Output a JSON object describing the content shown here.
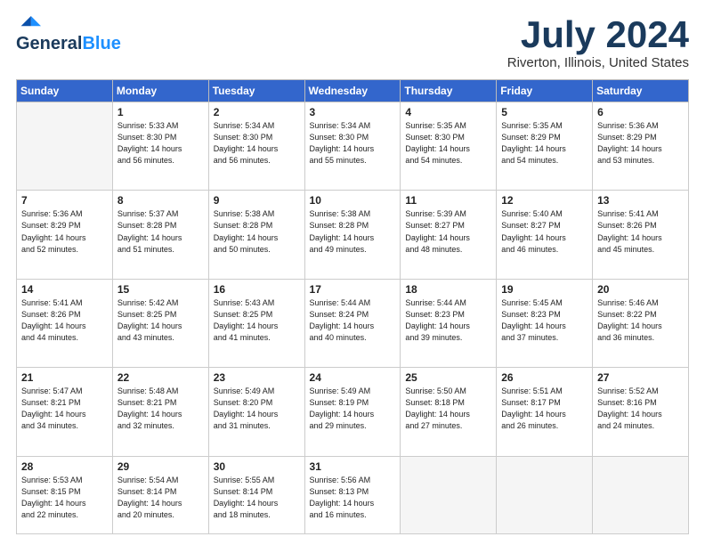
{
  "logo": {
    "name": "General",
    "name2": "Blue"
  },
  "title": "July 2024",
  "subtitle": "Riverton, Illinois, United States",
  "days": [
    "Sunday",
    "Monday",
    "Tuesday",
    "Wednesday",
    "Thursday",
    "Friday",
    "Saturday"
  ],
  "weeks": [
    [
      {
        "num": "",
        "info": ""
      },
      {
        "num": "1",
        "info": "Sunrise: 5:33 AM\nSunset: 8:30 PM\nDaylight: 14 hours\nand 56 minutes."
      },
      {
        "num": "2",
        "info": "Sunrise: 5:34 AM\nSunset: 8:30 PM\nDaylight: 14 hours\nand 56 minutes."
      },
      {
        "num": "3",
        "info": "Sunrise: 5:34 AM\nSunset: 8:30 PM\nDaylight: 14 hours\nand 55 minutes."
      },
      {
        "num": "4",
        "info": "Sunrise: 5:35 AM\nSunset: 8:30 PM\nDaylight: 14 hours\nand 54 minutes."
      },
      {
        "num": "5",
        "info": "Sunrise: 5:35 AM\nSunset: 8:29 PM\nDaylight: 14 hours\nand 54 minutes."
      },
      {
        "num": "6",
        "info": "Sunrise: 5:36 AM\nSunset: 8:29 PM\nDaylight: 14 hours\nand 53 minutes."
      }
    ],
    [
      {
        "num": "7",
        "info": "Sunrise: 5:36 AM\nSunset: 8:29 PM\nDaylight: 14 hours\nand 52 minutes."
      },
      {
        "num": "8",
        "info": "Sunrise: 5:37 AM\nSunset: 8:28 PM\nDaylight: 14 hours\nand 51 minutes."
      },
      {
        "num": "9",
        "info": "Sunrise: 5:38 AM\nSunset: 8:28 PM\nDaylight: 14 hours\nand 50 minutes."
      },
      {
        "num": "10",
        "info": "Sunrise: 5:38 AM\nSunset: 8:28 PM\nDaylight: 14 hours\nand 49 minutes."
      },
      {
        "num": "11",
        "info": "Sunrise: 5:39 AM\nSunset: 8:27 PM\nDaylight: 14 hours\nand 48 minutes."
      },
      {
        "num": "12",
        "info": "Sunrise: 5:40 AM\nSunset: 8:27 PM\nDaylight: 14 hours\nand 46 minutes."
      },
      {
        "num": "13",
        "info": "Sunrise: 5:41 AM\nSunset: 8:26 PM\nDaylight: 14 hours\nand 45 minutes."
      }
    ],
    [
      {
        "num": "14",
        "info": "Sunrise: 5:41 AM\nSunset: 8:26 PM\nDaylight: 14 hours\nand 44 minutes."
      },
      {
        "num": "15",
        "info": "Sunrise: 5:42 AM\nSunset: 8:25 PM\nDaylight: 14 hours\nand 43 minutes."
      },
      {
        "num": "16",
        "info": "Sunrise: 5:43 AM\nSunset: 8:25 PM\nDaylight: 14 hours\nand 41 minutes."
      },
      {
        "num": "17",
        "info": "Sunrise: 5:44 AM\nSunset: 8:24 PM\nDaylight: 14 hours\nand 40 minutes."
      },
      {
        "num": "18",
        "info": "Sunrise: 5:44 AM\nSunset: 8:23 PM\nDaylight: 14 hours\nand 39 minutes."
      },
      {
        "num": "19",
        "info": "Sunrise: 5:45 AM\nSunset: 8:23 PM\nDaylight: 14 hours\nand 37 minutes."
      },
      {
        "num": "20",
        "info": "Sunrise: 5:46 AM\nSunset: 8:22 PM\nDaylight: 14 hours\nand 36 minutes."
      }
    ],
    [
      {
        "num": "21",
        "info": "Sunrise: 5:47 AM\nSunset: 8:21 PM\nDaylight: 14 hours\nand 34 minutes."
      },
      {
        "num": "22",
        "info": "Sunrise: 5:48 AM\nSunset: 8:21 PM\nDaylight: 14 hours\nand 32 minutes."
      },
      {
        "num": "23",
        "info": "Sunrise: 5:49 AM\nSunset: 8:20 PM\nDaylight: 14 hours\nand 31 minutes."
      },
      {
        "num": "24",
        "info": "Sunrise: 5:49 AM\nSunset: 8:19 PM\nDaylight: 14 hours\nand 29 minutes."
      },
      {
        "num": "25",
        "info": "Sunrise: 5:50 AM\nSunset: 8:18 PM\nDaylight: 14 hours\nand 27 minutes."
      },
      {
        "num": "26",
        "info": "Sunrise: 5:51 AM\nSunset: 8:17 PM\nDaylight: 14 hours\nand 26 minutes."
      },
      {
        "num": "27",
        "info": "Sunrise: 5:52 AM\nSunset: 8:16 PM\nDaylight: 14 hours\nand 24 minutes."
      }
    ],
    [
      {
        "num": "28",
        "info": "Sunrise: 5:53 AM\nSunset: 8:15 PM\nDaylight: 14 hours\nand 22 minutes."
      },
      {
        "num": "29",
        "info": "Sunrise: 5:54 AM\nSunset: 8:14 PM\nDaylight: 14 hours\nand 20 minutes."
      },
      {
        "num": "30",
        "info": "Sunrise: 5:55 AM\nSunset: 8:14 PM\nDaylight: 14 hours\nand 18 minutes."
      },
      {
        "num": "31",
        "info": "Sunrise: 5:56 AM\nSunset: 8:13 PM\nDaylight: 14 hours\nand 16 minutes."
      },
      {
        "num": "",
        "info": ""
      },
      {
        "num": "",
        "info": ""
      },
      {
        "num": "",
        "info": ""
      }
    ]
  ]
}
